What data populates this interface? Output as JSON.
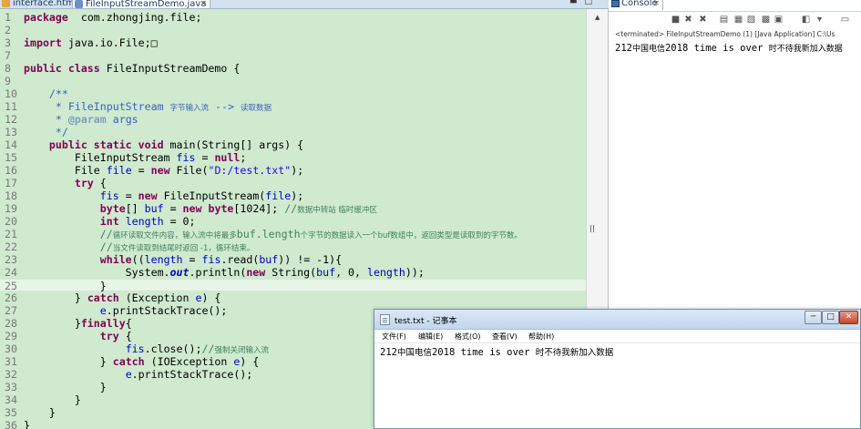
{
  "editor": {
    "tabs": [
      {
        "label": "interface.html"
      },
      {
        "label": "FileInputStreamDemo.java",
        "close": "×"
      }
    ],
    "lines": [
      {
        "n": "1",
        "segs": [
          [
            "kw",
            "package"
          ],
          [
            "",
            "  com.zhongjing.file;"
          ]
        ]
      },
      {
        "n": "2",
        "segs": []
      },
      {
        "n": "3",
        "fold": "+",
        "segs": [
          [
            "kw",
            "import"
          ],
          [
            "",
            " java.io.File;"
          ],
          [
            "",
            "□"
          ]
        ]
      },
      {
        "n": "7",
        "segs": []
      },
      {
        "n": "8",
        "segs": [
          [
            "kw",
            "public class"
          ],
          [
            "",
            " FileInputStreamDemo {"
          ]
        ]
      },
      {
        "n": "9",
        "segs": []
      },
      {
        "n": "10",
        "fold": "−",
        "segs": [
          [
            "",
            "    "
          ],
          [
            "jd",
            "/**"
          ]
        ]
      },
      {
        "n": "11",
        "segs": [
          [
            "jd",
            "     * FileInputStream "
          ],
          [
            "jd cjk",
            "字节输入流"
          ],
          [
            "jd",
            " --> "
          ],
          [
            "jd cjk",
            "读取数据"
          ]
        ]
      },
      {
        "n": "12",
        "segs": [
          [
            "jd",
            "     * "
          ],
          [
            "jdtag",
            "@param"
          ],
          [
            "jd",
            " args"
          ]
        ]
      },
      {
        "n": "13",
        "segs": [
          [
            "jd",
            "     */"
          ]
        ]
      },
      {
        "n": "14",
        "fold": "−",
        "segs": [
          [
            "",
            "    "
          ],
          [
            "kw",
            "public static void"
          ],
          [
            "",
            " main(String[] args) {"
          ]
        ]
      },
      {
        "n": "15",
        "segs": [
          [
            "",
            "        FileInputStream "
          ],
          [
            "fld",
            "fis"
          ],
          [
            "",
            " = "
          ],
          [
            "kw",
            "null"
          ],
          [
            "",
            ";"
          ]
        ]
      },
      {
        "n": "16",
        "segs": [
          [
            "",
            "        File "
          ],
          [
            "fld",
            "file"
          ],
          [
            "",
            " = "
          ],
          [
            "kw",
            "new"
          ],
          [
            "",
            " File("
          ],
          [
            "str",
            "\"D:/test.txt\""
          ],
          [
            "",
            ");"
          ]
        ]
      },
      {
        "n": "17",
        "segs": [
          [
            "",
            "        "
          ],
          [
            "kw",
            "try"
          ],
          [
            "",
            " {"
          ]
        ]
      },
      {
        "n": "18",
        "segs": [
          [
            "",
            "            "
          ],
          [
            "fld",
            "fis"
          ],
          [
            "",
            " = "
          ],
          [
            "kw",
            "new"
          ],
          [
            "",
            " FileInputStream("
          ],
          [
            "fld",
            "file"
          ],
          [
            "",
            ");"
          ]
        ]
      },
      {
        "n": "19",
        "segs": [
          [
            "",
            "            "
          ],
          [
            "kw",
            "byte"
          ],
          [
            "",
            "[] "
          ],
          [
            "fld",
            "buf"
          ],
          [
            "",
            " = "
          ],
          [
            "kw",
            "new"
          ],
          [
            "",
            " "
          ],
          [
            "kw",
            "byte"
          ],
          [
            "",
            "[1024]; "
          ],
          [
            "cm",
            "//"
          ],
          [
            "cm cjk",
            "数据中转站 临时缓冲区"
          ]
        ]
      },
      {
        "n": "20",
        "segs": [
          [
            "",
            "            "
          ],
          [
            "kw",
            "int"
          ],
          [
            "",
            " "
          ],
          [
            "fld",
            "length"
          ],
          [
            "",
            " = 0;"
          ]
        ]
      },
      {
        "n": "21",
        "segs": [
          [
            "",
            "            "
          ],
          [
            "cm",
            "//"
          ],
          [
            "cm cjk",
            "循环读取文件内容，输入流中将最多"
          ],
          [
            "cm",
            "buf.length"
          ],
          [
            "cm cjk",
            "个字节的数据读入一个buf数组中，返回类型是读取到的字节数。"
          ]
        ]
      },
      {
        "n": "22",
        "segs": [
          [
            "",
            "            "
          ],
          [
            "cm",
            "//"
          ],
          [
            "cm cjk",
            "当文件读取到结尾时返回 -1，循环结束。"
          ]
        ]
      },
      {
        "n": "23",
        "segs": [
          [
            "",
            "            "
          ],
          [
            "kw",
            "while"
          ],
          [
            "",
            "(("
          ],
          [
            "fld",
            "length"
          ],
          [
            "",
            " = "
          ],
          [
            "fld",
            "fis"
          ],
          [
            "",
            ".read("
          ],
          [
            "fld",
            "buf"
          ],
          [
            "",
            ")) != -1){"
          ]
        ]
      },
      {
        "n": "24",
        "segs": [
          [
            "",
            "                System."
          ],
          [
            "sf",
            "out"
          ],
          [
            "",
            ".println("
          ],
          [
            "kw",
            "new"
          ],
          [
            "",
            " String("
          ],
          [
            "fld",
            "buf"
          ],
          [
            "",
            ", 0, "
          ],
          [
            "fld",
            "length"
          ],
          [
            "",
            "));"
          ]
        ]
      },
      {
        "n": "25",
        "hl": true,
        "segs": [
          [
            "",
            "            }"
          ]
        ]
      },
      {
        "n": "26",
        "segs": [
          [
            "",
            "        } "
          ],
          [
            "kw",
            "catch"
          ],
          [
            "",
            " (Exception "
          ],
          [
            "fld",
            "e"
          ],
          [
            "",
            ") {"
          ]
        ]
      },
      {
        "n": "27",
        "segs": [
          [
            "",
            "            "
          ],
          [
            "fld",
            "e"
          ],
          [
            "",
            ".printStackTrace();"
          ]
        ]
      },
      {
        "n": "28",
        "segs": [
          [
            "",
            "        }"
          ],
          [
            "kw",
            "finally"
          ],
          [
            "",
            "{"
          ]
        ]
      },
      {
        "n": "29",
        "segs": [
          [
            "",
            "            "
          ],
          [
            "kw",
            "try"
          ],
          [
            "",
            " {"
          ]
        ]
      },
      {
        "n": "30",
        "segs": [
          [
            "",
            "                "
          ],
          [
            "fld",
            "fis"
          ],
          [
            "",
            ".close();"
          ],
          [
            "cm",
            "//"
          ],
          [
            "cm cjk",
            "强制关闭输入流"
          ]
        ]
      },
      {
        "n": "31",
        "segs": [
          [
            "",
            "            } "
          ],
          [
            "kw",
            "catch"
          ],
          [
            "",
            " (IOException "
          ],
          [
            "fld",
            "e"
          ],
          [
            "",
            ") {"
          ]
        ]
      },
      {
        "n": "32",
        "segs": [
          [
            "",
            "                "
          ],
          [
            "fld",
            "e"
          ],
          [
            "",
            ".printStackTrace();"
          ]
        ]
      },
      {
        "n": "33",
        "segs": [
          [
            "",
            "            }"
          ]
        ]
      },
      {
        "n": "34",
        "segs": [
          [
            "",
            "        }"
          ]
        ]
      },
      {
        "n": "35",
        "segs": [
          [
            "",
            "    }"
          ]
        ]
      },
      {
        "n": "36",
        "segs": [
          [
            "",
            "}"
          ]
        ]
      }
    ]
  },
  "console": {
    "tab_label": "Console",
    "tab_close": "×",
    "status": "<terminated> FileInputStreamDemo (1) [Java Application] C:\\Us",
    "output_num": "212",
    "output_cjk1": "中国电信",
    "output_mid": "2018 time is over ",
    "output_cjk2": "时不待我新加入数据",
    "toolbar_icons": [
      "stop-icon",
      "remove-launch-icon",
      "remove-all-icon",
      "clear-console-icon",
      "scroll-lock-icon",
      "word-wrap-icon",
      "pin-console-icon",
      "display-selected-icon",
      "open-console-icon",
      "view-menu-icon",
      "minimize-icon"
    ]
  },
  "notepad": {
    "title": "test.txt - 记事本",
    "menu": [
      "文件(F)",
      "编辑(E)",
      "格式(O)",
      "查看(V)",
      "帮助(H)"
    ],
    "content_num": "212",
    "content_cjk1": "中国电信",
    "content_mid": "2018 time is over ",
    "content_cjk2": "时不待我新加入数据",
    "btn_min": "─",
    "btn_max": "□",
    "btn_close": "✕"
  }
}
